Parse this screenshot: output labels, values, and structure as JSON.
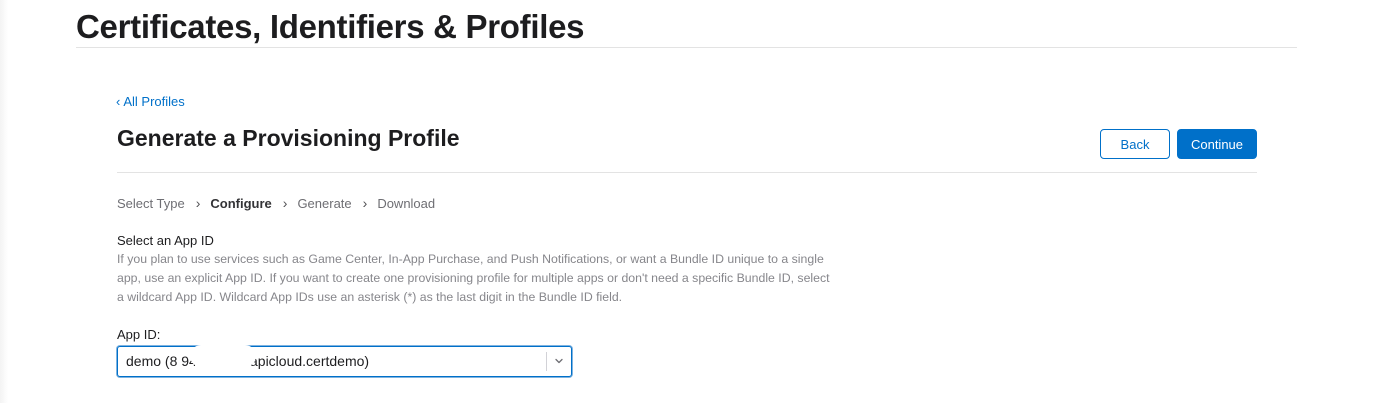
{
  "header": {
    "title": "Certificates, Identifiers & Profiles"
  },
  "nav": {
    "back_link_chevron": "‹",
    "back_link_label": "All Profiles"
  },
  "section": {
    "heading": "Generate a Provisioning Profile",
    "back_button": "Back",
    "continue_button": "Continue"
  },
  "steps": [
    {
      "label": "Select Type",
      "active": false
    },
    {
      "label": "Configure",
      "active": true
    },
    {
      "label": "Generate",
      "active": false
    },
    {
      "label": "Download",
      "active": false
    }
  ],
  "step_separator": "›",
  "form": {
    "select_app_id_label": "Select an App ID",
    "help_text": "If you plan to use services such as Game Center, In-App Purchase, and Push Notifications, or want a Bundle ID unique to a single app, use an explicit App ID. If you want to create one provisioning profile for multiple apps or don't need a specific Bundle ID, select a wildcard App ID. Wildcard App IDs use an asterisk (*) as the last digit in the Bundle ID field.",
    "app_id_label": "App ID:",
    "app_id_value": "demo (8            94c  V.com.apicloud.certdemo)"
  },
  "colors": {
    "accent": "#0070c9",
    "text_primary": "#1d1d1f",
    "text_secondary": "#86868b",
    "divider": "#e3e3e3"
  },
  "icons": {
    "select_chevron": "chevron-down-icon"
  }
}
